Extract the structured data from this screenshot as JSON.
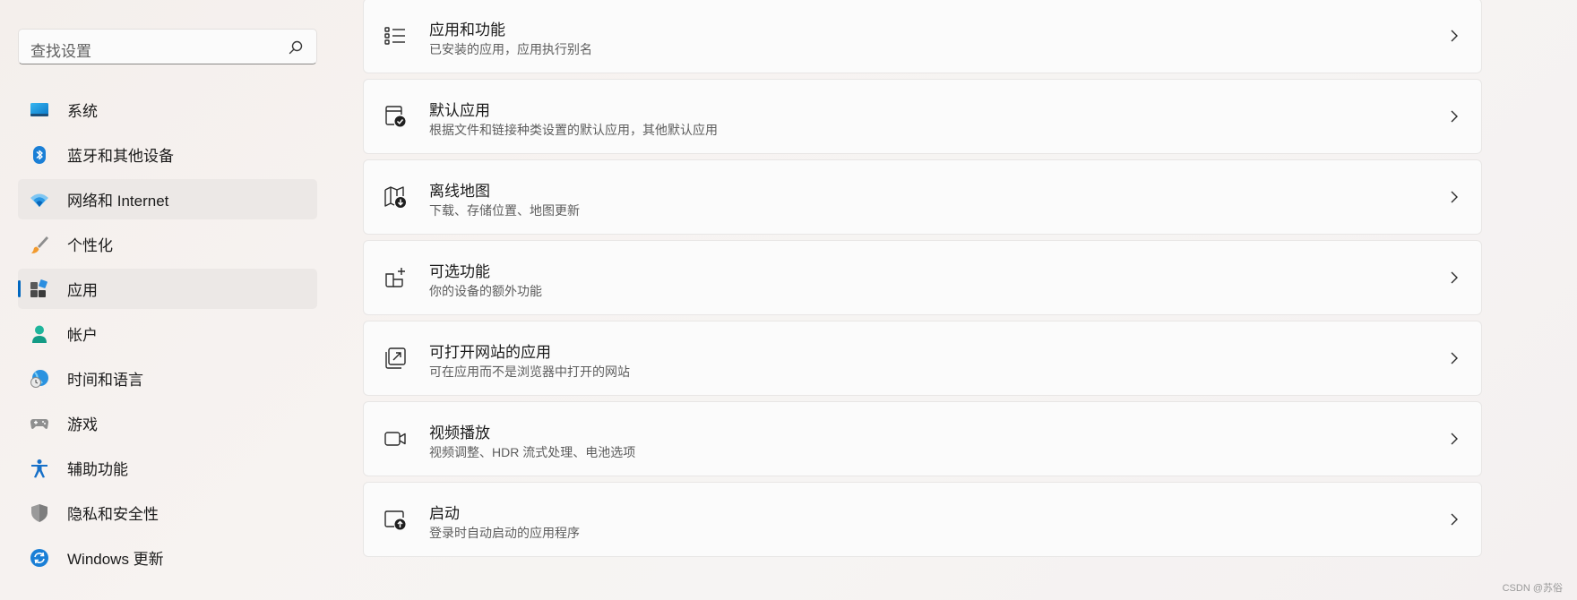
{
  "search": {
    "placeholder": "查找设置"
  },
  "sidebar": {
    "items": [
      {
        "label": "系统",
        "icon": "system-icon"
      },
      {
        "label": "蓝牙和其他设备",
        "icon": "bluetooth-icon"
      },
      {
        "label": "网络和 Internet",
        "icon": "wifi-icon"
      },
      {
        "label": "个性化",
        "icon": "paintbrush-icon"
      },
      {
        "label": "应用",
        "icon": "apps-icon"
      },
      {
        "label": "帐户",
        "icon": "account-icon"
      },
      {
        "label": "时间和语言",
        "icon": "time-language-icon"
      },
      {
        "label": "游戏",
        "icon": "gamepad-icon"
      },
      {
        "label": "辅助功能",
        "icon": "accessibility-icon"
      },
      {
        "label": "隐私和安全性",
        "icon": "shield-icon"
      },
      {
        "label": "Windows 更新",
        "icon": "update-icon"
      }
    ]
  },
  "cards": [
    {
      "title": "应用和功能",
      "subtitle": "已安装的应用，应用执行别名",
      "icon": "list-icon"
    },
    {
      "title": "默认应用",
      "subtitle": "根据文件和链接种类设置的默认应用，其他默认应用",
      "icon": "default-apps-icon"
    },
    {
      "title": "离线地图",
      "subtitle": "下载、存储位置、地图更新",
      "icon": "map-icon"
    },
    {
      "title": "可选功能",
      "subtitle": "你的设备的额外功能",
      "icon": "optional-features-icon"
    },
    {
      "title": "可打开网站的应用",
      "subtitle": "可在应用而不是浏览器中打开的网站",
      "icon": "open-website-icon"
    },
    {
      "title": "视频播放",
      "subtitle": "视频调整、HDR 流式处理、电池选项",
      "icon": "video-icon"
    },
    {
      "title": "启动",
      "subtitle": "登录时自动启动的应用程序",
      "icon": "startup-icon"
    }
  ],
  "watermark": "CSDN @苏俗",
  "colors": {
    "accent": "#0067c0",
    "selected_bg": "#ece8e6"
  }
}
